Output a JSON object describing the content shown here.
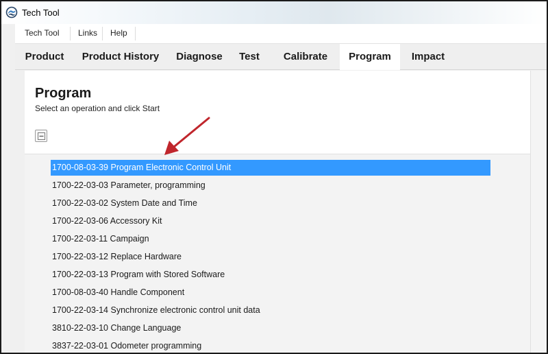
{
  "window": {
    "title": "Tech Tool"
  },
  "menu": {
    "items": [
      "Tech Tool",
      "Links",
      "Help"
    ]
  },
  "tabs": [
    {
      "label": "Product"
    },
    {
      "label": "Product History"
    },
    {
      "label": "Diagnose"
    },
    {
      "label": "Test"
    },
    {
      "label": "Calibrate"
    },
    {
      "label": "Program",
      "active": true
    },
    {
      "label": "Impact"
    }
  ],
  "page": {
    "title": "Program",
    "subtitle": "Select an operation and click Start"
  },
  "operations": [
    {
      "label": "1700-08-03-39 Program Electronic Control Unit",
      "selected": true
    },
    {
      "label": "1700-22-03-03 Parameter, programming"
    },
    {
      "label": "1700-22-03-02 System Date and Time"
    },
    {
      "label": "1700-22-03-06 Accessory Kit"
    },
    {
      "label": "1700-22-03-11 Campaign"
    },
    {
      "label": "1700-22-03-12 Replace Hardware"
    },
    {
      "label": "1700-22-03-13 Program with Stored Software"
    },
    {
      "label": "1700-08-03-40 Handle Component"
    },
    {
      "label": "1700-22-03-14 Synchronize electronic control unit data"
    },
    {
      "label": "3810-22-03-10 Change Language"
    },
    {
      "label": "3837-22-03-01 Odometer programming"
    }
  ],
  "colors": {
    "selection": "#3399ff",
    "annotation_arrow": "#c0262c"
  }
}
